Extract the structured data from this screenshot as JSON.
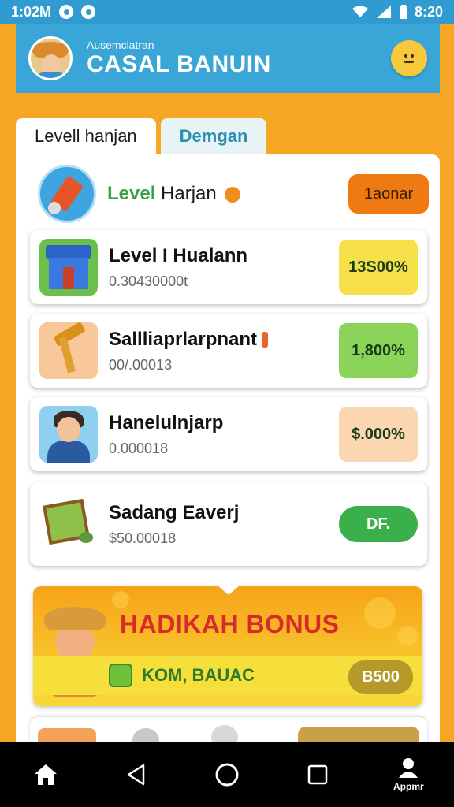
{
  "status": {
    "time": "1:02M",
    "right_time": "8:20"
  },
  "header": {
    "subtitle": "Ausemclatran",
    "title": "CASAL BANUIN"
  },
  "tabs": [
    {
      "label": "Levell hanjan"
    },
    {
      "label": "Demgan"
    }
  ],
  "featured": {
    "label_green": "Level",
    "label_rest": " Harjan",
    "button": "1aonar"
  },
  "cards": [
    {
      "title": "Level I Hualann",
      "subtitle": "0.30430000t",
      "value": "13S00%",
      "value_color": "#f5e04a"
    },
    {
      "title": "Sallliaprlarpnant",
      "subtitle": "00/.00013",
      "value": "1,800%",
      "value_color": "#8ad45a"
    },
    {
      "title": "Hanelulnjarp",
      "subtitle": "0.000018",
      "value": "$.000%",
      "value_color": "#fad7b0"
    },
    {
      "title": "Sadang Eaverj",
      "subtitle": "$50.00018",
      "value": "DF.",
      "value_color": "#3ab04a"
    }
  ],
  "bonus": {
    "title": "HADIKAH BONUS",
    "code": "KOM, BAUAC",
    "button": "B500"
  },
  "nav": {
    "account_label": "Appmr"
  },
  "colors": {
    "primary": "#3aa6d8",
    "background": "#f5a623",
    "accent_orange": "#f07a12",
    "bonus_red": "#d82a2a"
  }
}
